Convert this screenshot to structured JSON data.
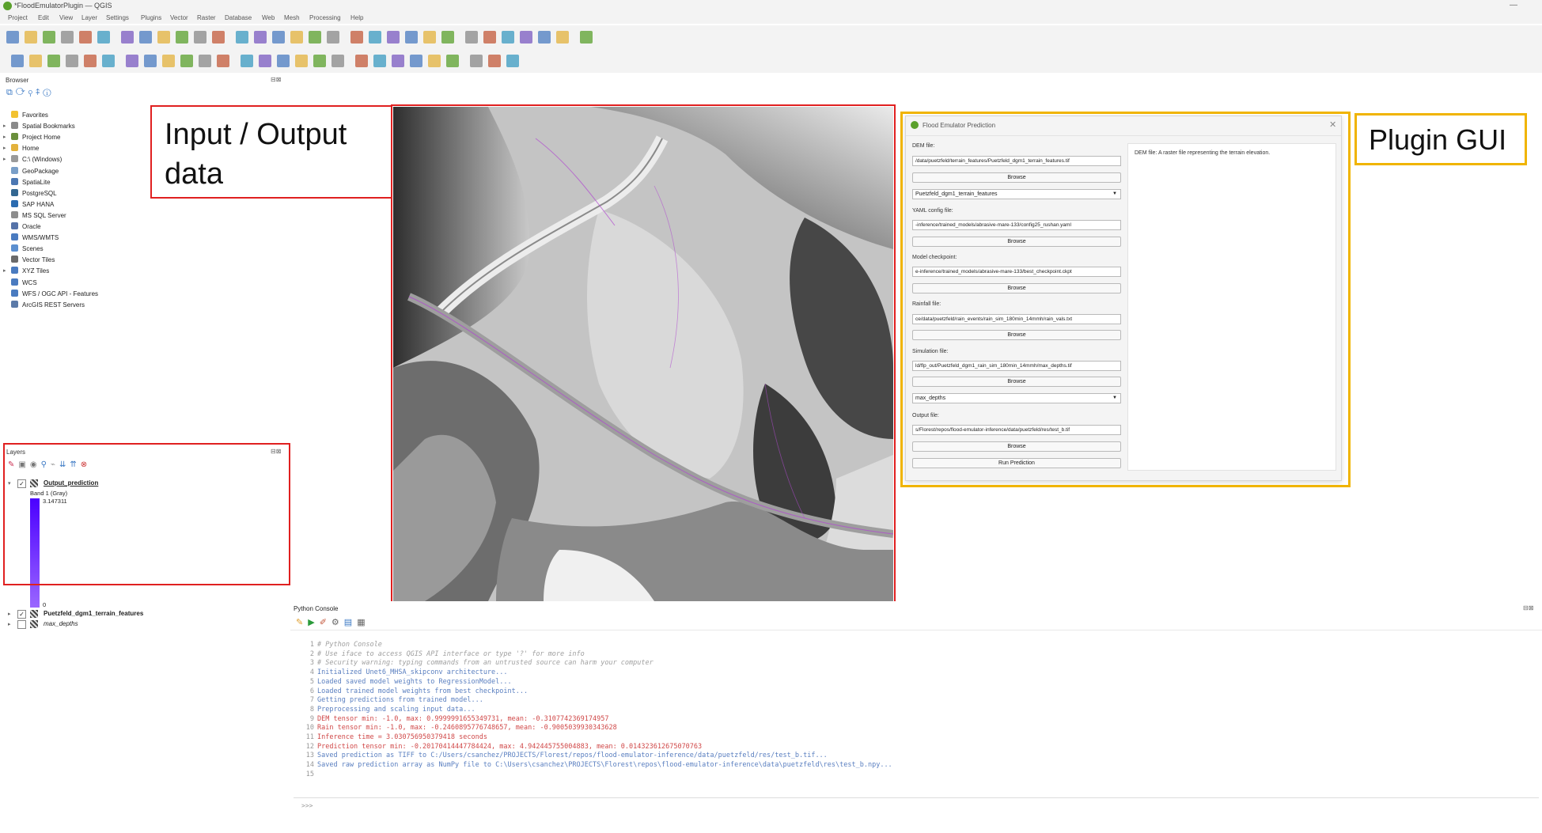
{
  "window": {
    "title": "*FloodEmulatorPlugin — QGIS"
  },
  "menu": [
    "Project",
    "Edit",
    "View",
    "Layer",
    "Settings",
    "Plugins",
    "Vector",
    "Raster",
    "Database",
    "Web",
    "Mesh",
    "Processing",
    "Help"
  ],
  "browser": {
    "title": "Browser",
    "items": [
      {
        "label": "Favorites",
        "icon": "star-icon",
        "color": "#f2c230",
        "expand": false
      },
      {
        "label": "Spatial Bookmarks",
        "icon": "bookmark-icon",
        "color": "#8a8a8a",
        "expand": true
      },
      {
        "label": "Project Home",
        "icon": "folder-icon",
        "color": "#6a8f3c",
        "expand": true
      },
      {
        "label": "Home",
        "icon": "folder-icon",
        "color": "#e3b23c",
        "expand": true
      },
      {
        "label": "C:\\ (Windows)",
        "icon": "drive-icon",
        "color": "#9a9a9a",
        "expand": true
      },
      {
        "label": "GeoPackage",
        "icon": "geopackage-icon",
        "color": "#7a9fc8",
        "expand": false
      },
      {
        "label": "SpatiaLite",
        "icon": "spatialite-icon",
        "color": "#4c78b3",
        "expand": false
      },
      {
        "label": "PostgreSQL",
        "icon": "postgresql-icon",
        "color": "#336791",
        "expand": false
      },
      {
        "label": "SAP HANA",
        "icon": "sap-hana-icon",
        "color": "#2b6cb0",
        "expand": false
      },
      {
        "label": "MS SQL Server",
        "icon": "mssql-icon",
        "color": "#8d8d8d",
        "expand": false
      },
      {
        "label": "Oracle",
        "icon": "oracle-icon",
        "color": "#5572a8",
        "expand": false
      },
      {
        "label": "WMS/WMTS",
        "icon": "wms-icon",
        "color": "#4a7bc0",
        "expand": false
      },
      {
        "label": "Scenes",
        "icon": "scenes-icon",
        "color": "#5b8fd0",
        "expand": false
      },
      {
        "label": "Vector Tiles",
        "icon": "vector-tiles-icon",
        "color": "#6a6a6a",
        "expand": false
      },
      {
        "label": "XYZ Tiles",
        "icon": "xyz-tiles-icon",
        "color": "#4a7bc0",
        "expand": true
      },
      {
        "label": "WCS",
        "icon": "wcs-icon",
        "color": "#4a7bc0",
        "expand": false
      },
      {
        "label": "WFS / OGC API - Features",
        "icon": "wfs-icon",
        "color": "#4a7bc0",
        "expand": false
      },
      {
        "label": "ArcGIS REST Servers",
        "icon": "arcgis-icon",
        "color": "#5b7aa8",
        "expand": false
      }
    ]
  },
  "layers": {
    "title": "Layers",
    "output_layer": "Output_prediction",
    "band_label": "Band 1 (Gray)",
    "max_value": "3.147311",
    "min_value": "0",
    "terrain_layer": "Puetzfeld_dgm1_terrain_features",
    "depth_layer": "max_depths",
    "ramp_colors": [
      "#4b00ff",
      "#9a66ff"
    ]
  },
  "annotations": {
    "io_label": "Input / Output data",
    "plugin_label": "Plugin GUI",
    "red": "#e02020",
    "yellow": "#f0b400"
  },
  "dialog": {
    "title": "Flood Emulator Prediction",
    "dem_label": "DEM file:",
    "dem_value": "/data/puetzfeld/terrain_features/Puetzfeld_dgm1_terrain_features.tif",
    "browse": "Browse",
    "dem_layer": "Puetzfeld_dgm1_terrain_features",
    "yaml_label": "YAML config file:",
    "yaml_value": "-inference/trained_models/abrasive-mare-133/config25_rushan.yaml",
    "ckpt_label": "Model checkpoint:",
    "ckpt_value": "e-inference/trained_models/abrasive-mare-133/best_checkpoint.ckpt",
    "rain_label": "Rainfall file:",
    "rain_value": "ce/data/puetzfeld/rain_events/rain_sim_180min_14mmh/rain_vals.txt",
    "sim_label": "Simulation file:",
    "sim_value": "ld/flp_out/Puetzfeld_dgm1_rain_sim_180min_14mmh/max_depths.tif",
    "sim_layer": "max_depths",
    "out_label": "Output file:",
    "out_value": "s/Florest/repos/flood-emulator-inference/data/puetzfeld/res/test_b.tif",
    "run": "Run Prediction",
    "help_text": "DEM file: A raster file representing the terrain elevation."
  },
  "console": {
    "title": "Python Console",
    "prompt": ">>>",
    "lines": [
      {
        "n": "1",
        "text": "# Python Console",
        "color": "#a0a0a0",
        "italic": true
      },
      {
        "n": "2",
        "text": "# Use iface to access QGIS API interface or type '?' for more info",
        "color": "#a0a0a0",
        "italic": true
      },
      {
        "n": "3",
        "text": "# Security warning: typing commands from an untrusted source can harm your computer",
        "color": "#a0a0a0",
        "italic": true
      },
      {
        "n": "4",
        "text": "Initialized Unet6_MHSA_skipconv architecture...",
        "color": "#5a7fc0",
        "italic": false
      },
      {
        "n": "5",
        "text": "Loaded saved model weights to RegressionModel...",
        "color": "#5a7fc0",
        "italic": false
      },
      {
        "n": "6",
        "text": "Loaded trained model weights from best checkpoint...",
        "color": "#5a7fc0",
        "italic": false
      },
      {
        "n": "7",
        "text": "Getting predictions from trained model...",
        "color": "#5a7fc0",
        "italic": false
      },
      {
        "n": "8",
        "text": "Preprocessing and scaling input data...",
        "color": "#5a7fc0",
        "italic": false
      },
      {
        "n": "9",
        "text": "DEM tensor min: -1.0, max: 0.9999991655349731, mean: -0.3107742369174957",
        "color": "#d04848",
        "italic": false
      },
      {
        "n": "10",
        "text": "Rain tensor min: -1.0, max: -0.2460895776748657, mean: -0.9005039930343628",
        "color": "#d04848",
        "italic": false
      },
      {
        "n": "11",
        "text": "Inference time = 3.030756950379418 seconds",
        "color": "#d04848",
        "italic": false
      },
      {
        "n": "12",
        "text": "Prediction tensor min: -0.20170414447784424, max: 4.942445755004883, mean: 0.014323612675070763",
        "color": "#d04848",
        "italic": false
      },
      {
        "n": "13",
        "text": "Saved prediction as TIFF to C:/Users/csanchez/PROJECTS/Florest/repos/flood-emulator-inference/data/puetzfeld/res/test_b.tif...",
        "color": "#5a7fc0",
        "italic": false
      },
      {
        "n": "14",
        "text": "Saved raw prediction array as NumPy file to C:\\Users\\csanchez\\PROJECTS\\Florest\\repos\\flood-emulator-inference\\data\\puetzfeld\\res\\test_b.npy...",
        "color": "#5a7fc0",
        "italic": false
      },
      {
        "n": "15",
        "text": "",
        "color": "#5a7fc0",
        "italic": false
      }
    ]
  },
  "icons": {
    "toolbar1": [
      "new-project-icon",
      "open-project-icon",
      "save-project-icon",
      "save-as-icon",
      "print-layout-icon",
      "style-manager-icon",
      "pan-icon",
      "pan-to-selection-icon",
      "zoom-in-icon",
      "zoom-out-icon",
      "zoom-full-icon",
      "zoom-to-selection-icon",
      "zoom-to-layer-icon",
      "zoom-native-icon",
      "zoom-last-icon",
      "zoom-next-icon",
      "new-map-view-icon",
      "new-3d-view-icon",
      "new-bookmark-icon",
      "show-bookmarks-icon",
      "temporal-icon",
      "refresh-icon",
      "identify-icon",
      "select-icon",
      "deselect-icon",
      "field-calculator-icon",
      "statistics-icon",
      "attribute-table-icon",
      "measure-icon",
      "annotation-icon",
      "tips-icon"
    ],
    "toolbar2": [
      "data-source-manager-icon",
      "new-layer-icon",
      "add-vector-icon",
      "add-raster-icon",
      "add-mesh-icon",
      "edit-pencil-icon",
      "digitize-icon",
      "add-feature-icon",
      "vertex-tool-icon",
      "delete-icon",
      "cut-icon",
      "copy-icon",
      "paste-icon",
      "undo-icon",
      "redo-icon",
      "label-icon",
      "label-pin-icon",
      "label-show-icon",
      "label-move-icon",
      "label-rotate-icon",
      "label-change-icon",
      "diagram-icon",
      "python-console-icon",
      "plugin-icon",
      "hide-icon",
      "processing-icon",
      "flood-emulator-icon"
    ]
  }
}
